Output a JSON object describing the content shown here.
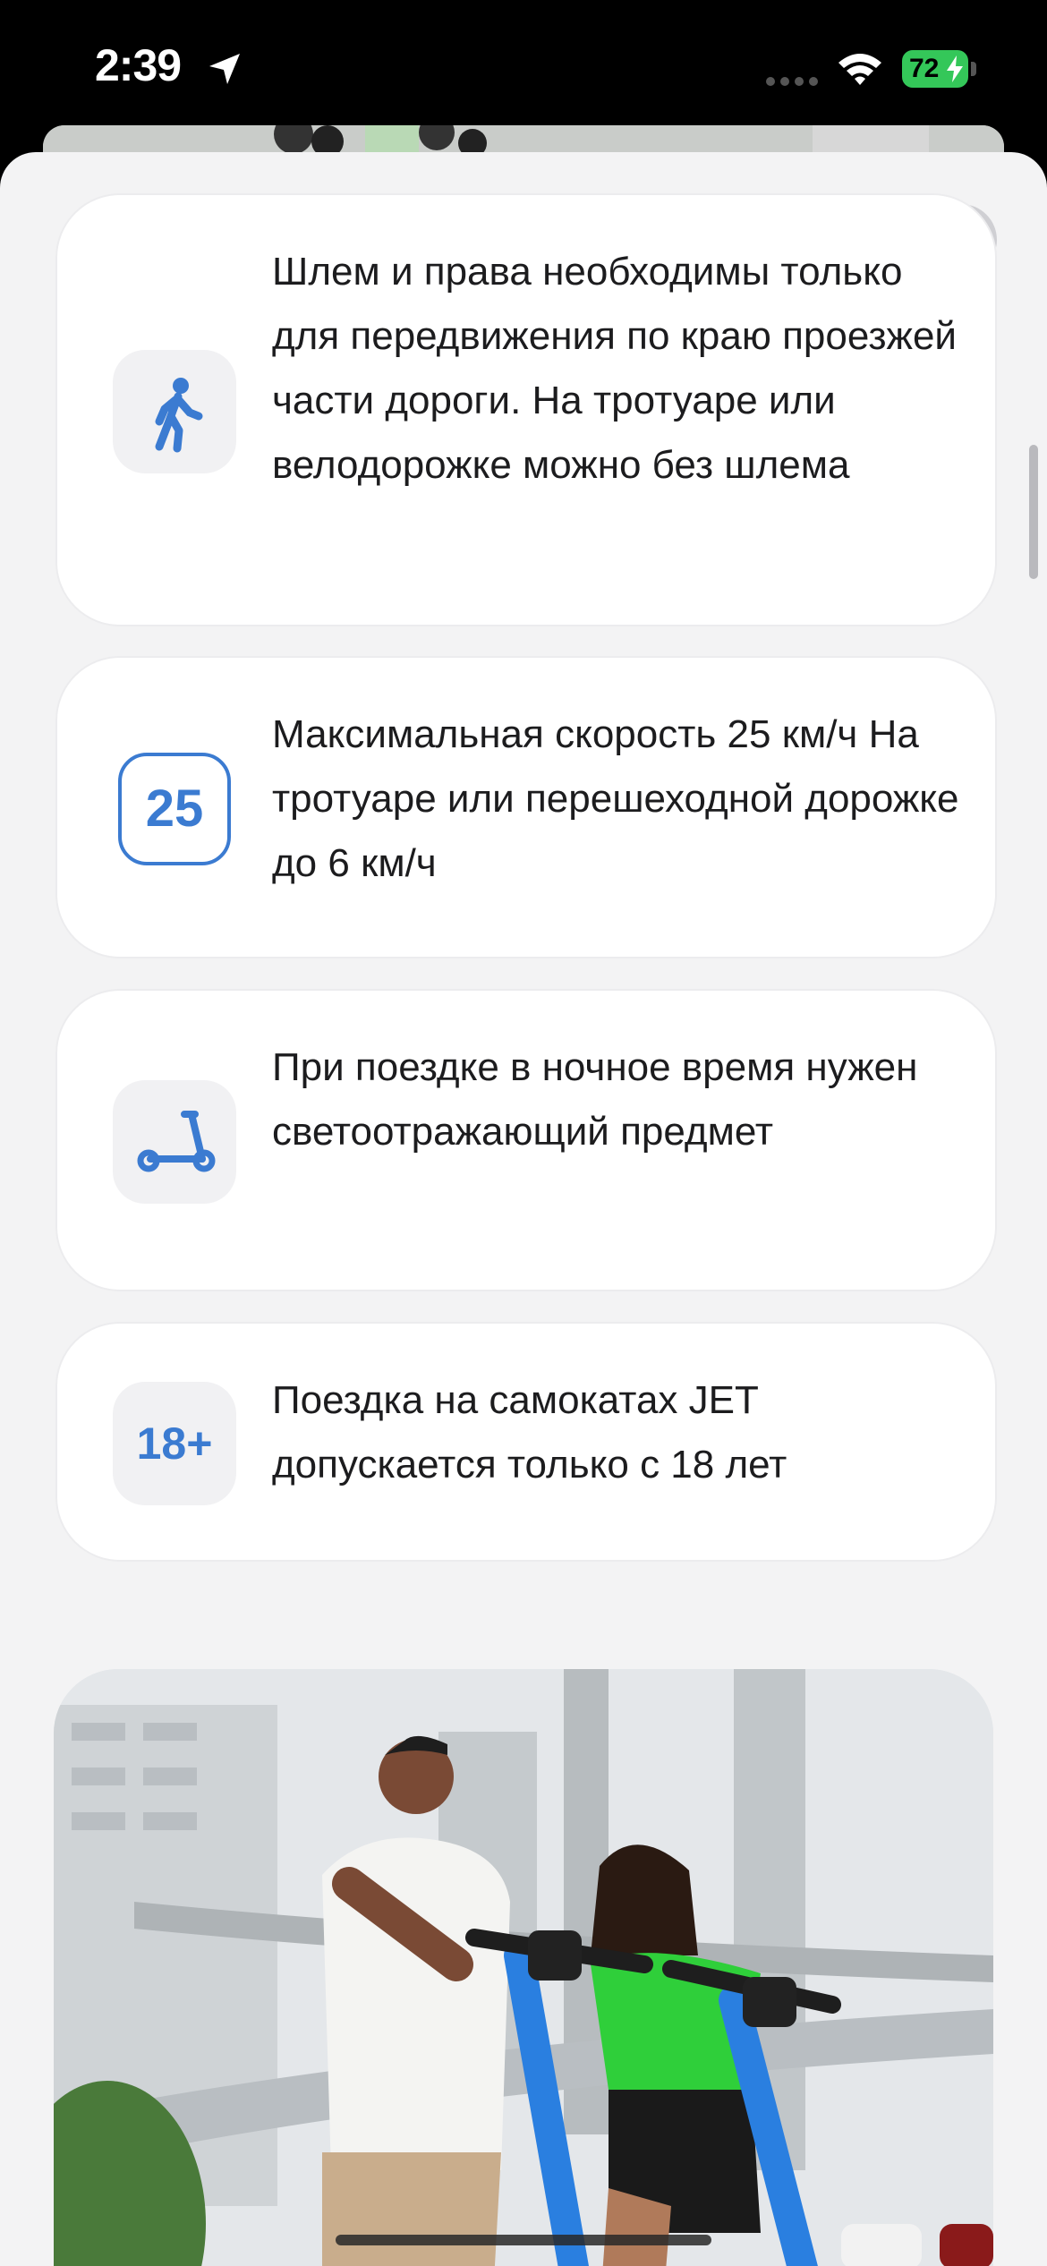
{
  "status_bar": {
    "time": "2:39",
    "battery": "72"
  },
  "cards": [
    {
      "icon": "walking-person-icon",
      "text": "Шлем и права необходимы только для передвижения по краю проезжей части дороги. На тротуаре или велодорожке можно без шлема"
    },
    {
      "icon": "speed-limit-badge",
      "badge": "25",
      "text": "Максимальная скорость 25 км/ч На тротуаре или перешеходной дорожке до 6 км/ч"
    },
    {
      "icon": "scooter-icon",
      "text": "При поездке в ночное время нужен светоотражающий предмет"
    },
    {
      "icon": "age-limit-badge",
      "badge": "18+",
      "text": "Поездка на самокатах JET допускается только с 18 лет"
    }
  ],
  "colors": {
    "accent": "#3b7bd1",
    "sheet_bg": "#f3f3f4",
    "card_bg": "#ffffff"
  },
  "photo": {
    "description_icon": "promo-photo"
  }
}
